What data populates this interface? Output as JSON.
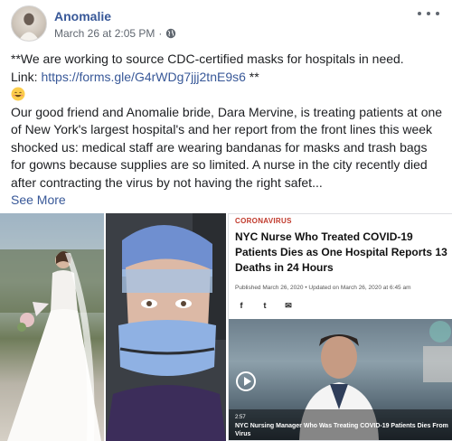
{
  "post": {
    "page_name": "Anomalie",
    "date": "March 26 at 2:05 PM",
    "separator": "·",
    "privacy_icon": "globe-icon",
    "more_icon": "more-options-icon",
    "line1": "**We are working to source CDC-certified masks for hospitals in need.",
    "link_prefix": "Link: ",
    "link_url": "https://forms.gle/G4rWDg7jjj2tnE9s6",
    "link_suffix": " **",
    "emoji": "grinning-face-emoji",
    "body": "Our good friend and Anomalie bride, Dara Mervine, is treating patients at one of New York's largest hospital's and her report from the front lines this week shocked us: medical staff are wearing bandanas for masks and trash bags for gowns because supplies are so limited. A nurse in the city recently died after contracting the virus by not having the right safet...",
    "see_more": "See More"
  },
  "article": {
    "kicker": "CORONAVIRUS",
    "title": "NYC Nurse Who Treated COVID-19 Patients Dies as One Hospital Reports 13 Deaths in 24 Hours",
    "date_line": "Published March 26, 2020 • Updated on March 26, 2020 at 6:45 am",
    "share": [
      "f",
      "t",
      "✉"
    ],
    "video_time": "2:57",
    "video_caption": "NYC Nursing Manager Who Was Treating COVID-19 Patients Dies From Virus"
  }
}
